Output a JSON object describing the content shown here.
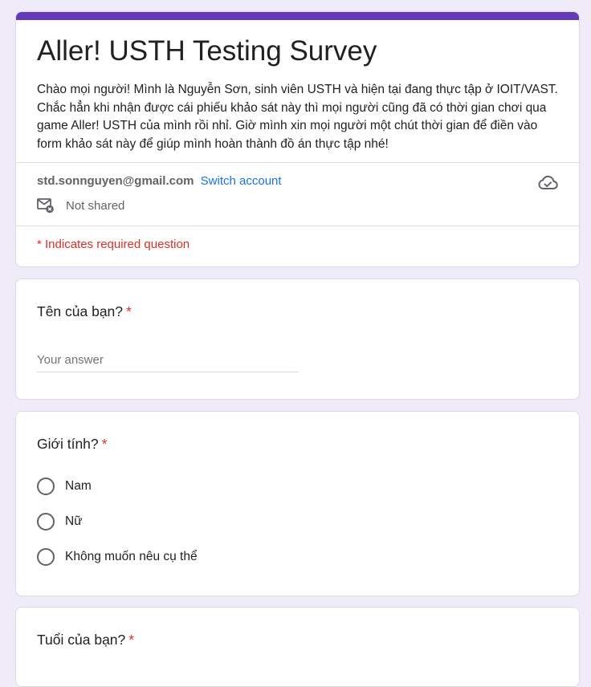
{
  "form": {
    "title": "Aller! USTH Testing Survey",
    "description": "Chào mọi người! Mình là Nguyễn Sơn, sinh viên USTH và hiện tại đang thực tập ở IOIT/VAST. Chắc hẳn khi nhận được cái phiếu khảo sát này thì mọi người cũng đã có thời gian chơi qua game Aller! USTH của mình rồi nhỉ. Giờ mình xin mọi người một chút thời gian để điền vào form khảo sát này để giúp mình hoàn thành đồ án thực tập nhé!",
    "accent_color": "#673ab7"
  },
  "account": {
    "email": "std.sonnguyen@gmail.com",
    "switch_label": "Switch account",
    "not_shared_label": "Not shared",
    "cloud_icon": "cloud-saved-icon",
    "mail_icon": "mail-not-shared-icon"
  },
  "required_note": "* Indicates required question",
  "questions": [
    {
      "title": "Tên của bạn?",
      "required_mark": "*",
      "type": "short-answer",
      "placeholder": "Your answer",
      "value": ""
    },
    {
      "title": "Giới tính?",
      "required_mark": "*",
      "type": "radio",
      "options": [
        "Nam",
        "Nữ",
        "Không muốn nêu cụ thể"
      ]
    },
    {
      "title": "Tuổi của bạn?",
      "required_mark": "*",
      "type": "unknown"
    }
  ]
}
